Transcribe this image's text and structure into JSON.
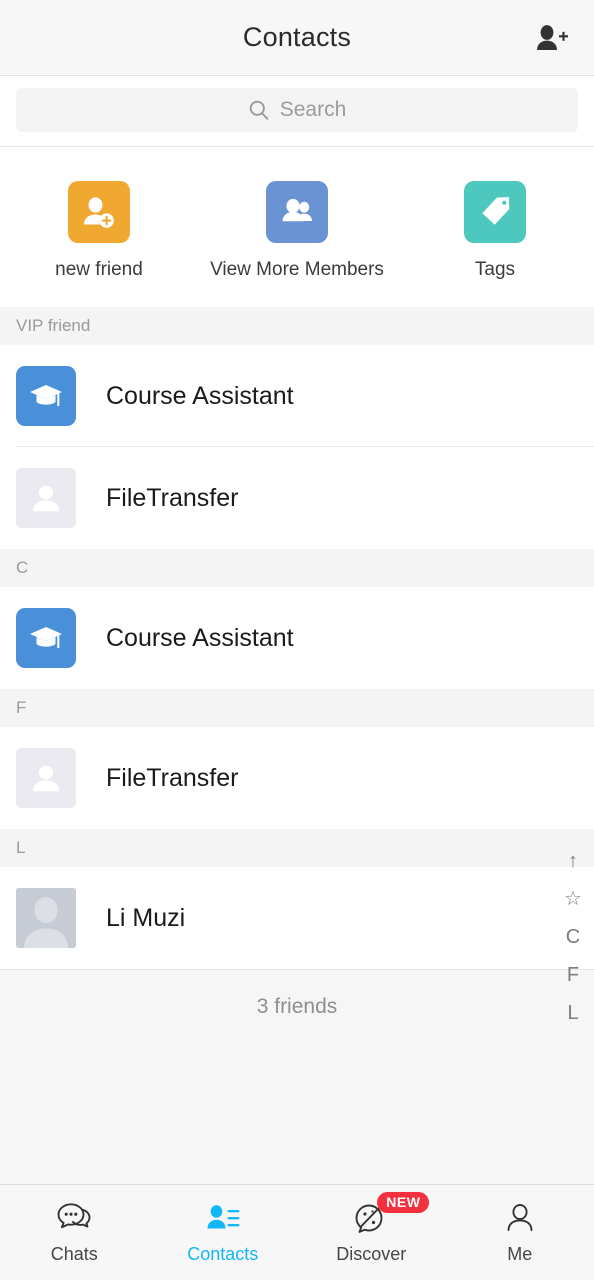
{
  "header": {
    "title": "Contacts",
    "add_contact_icon": "person-add-icon"
  },
  "search": {
    "placeholder": "Search",
    "icon": "search-icon"
  },
  "quick_actions": [
    {
      "label": "new friend",
      "icon": "person-add-icon",
      "color": "#f0a830"
    },
    {
      "label": "View More Members",
      "icon": "group-people-icon",
      "color": "#6a93d4"
    },
    {
      "label": "Tags",
      "icon": "tag-icon",
      "color": "#4cc8be"
    }
  ],
  "sections": [
    {
      "title": "VIP friend",
      "contacts": [
        {
          "name": "Course Assistant",
          "avatar": "graduation-cap-avatar"
        },
        {
          "name": "FileTransfer",
          "avatar": "file-transfer-avatar"
        }
      ]
    },
    {
      "title": "C",
      "contacts": [
        {
          "name": "Course Assistant",
          "avatar": "graduation-cap-avatar"
        }
      ]
    },
    {
      "title": "F",
      "contacts": [
        {
          "name": "FileTransfer",
          "avatar": "file-transfer-avatar"
        }
      ]
    },
    {
      "title": "L",
      "contacts": [
        {
          "name": "Li Muzi",
          "avatar": "default-person-avatar"
        }
      ]
    }
  ],
  "footer": {
    "friends_count_text": "3 friends"
  },
  "index_bar": {
    "items": [
      "↑",
      "☆",
      "C",
      "F",
      "L"
    ],
    "icon_names": [
      "arrow-up-icon",
      "star-icon",
      "index-letter-c",
      "index-letter-f",
      "index-letter-l"
    ]
  },
  "tabbar": {
    "active": "Contacts",
    "active_color": "#12b7f5",
    "tabs": [
      {
        "label": "Chats",
        "icon": "chat-bubbles-icon",
        "badge": ""
      },
      {
        "label": "Contacts",
        "icon": "contacts-person-list-icon",
        "badge": ""
      },
      {
        "label": "Discover",
        "icon": "discover-planet-icon",
        "badge": "NEW"
      },
      {
        "label": "Me",
        "icon": "person-outline-icon",
        "badge": ""
      }
    ]
  }
}
